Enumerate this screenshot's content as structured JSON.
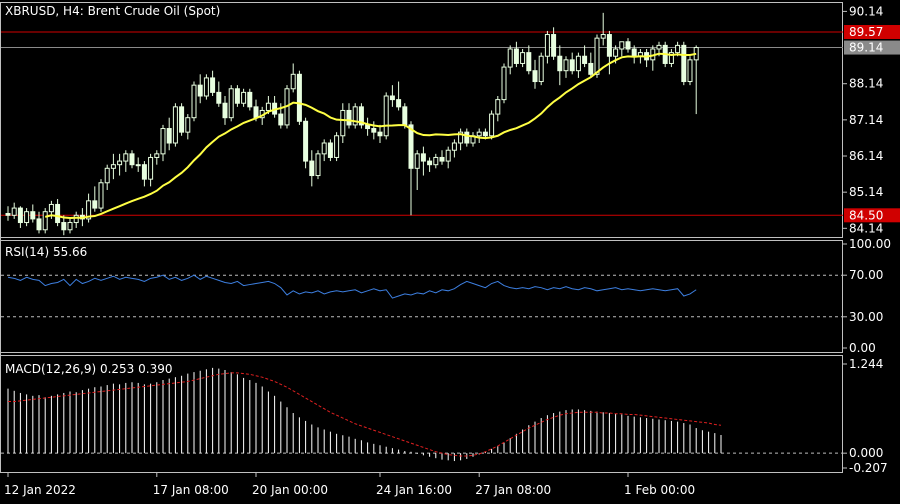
{
  "colors": {
    "background": "#000000",
    "frame": "#c0c0c0",
    "text": "#ffffff",
    "candle": "#e8ffe0",
    "ma": "#ffff44",
    "level_line": "#d00000",
    "bid_line": "#8a8a8a",
    "rsi_line": "#3d7fe0",
    "macd_hist": "#ffffff",
    "macd_signal": "#e02020",
    "grid_dash": "#bdbdbd"
  },
  "chart_data": [
    {
      "type": "candlestick",
      "title": "XBRUSD, H4:  Brent Crude Oil (Spot)",
      "ylim": [
        83.9,
        90.4
      ],
      "yticks": [
        "90.14",
        "88.14",
        "87.14",
        "86.14",
        "85.14",
        "84.14"
      ],
      "ytick_values": [
        90.14,
        88.14,
        87.14,
        86.14,
        85.14,
        84.14
      ],
      "xticks": [
        "12 Jan 2022",
        "17 Jan 08:00",
        "20 Jan 00:00",
        "24 Jan 16:00",
        "27 Jan 08:00",
        "1 Feb 00:00"
      ],
      "xtick_index": [
        0,
        24,
        40,
        60,
        76,
        100
      ],
      "levels": [
        {
          "label": "89.57",
          "value": 89.57
        },
        {
          "label": "84.50",
          "value": 84.5
        }
      ],
      "bid": {
        "label": "89.14",
        "value": 89.14
      },
      "candles": [
        [
          84.55,
          84.75,
          84.35,
          84.5
        ],
        [
          84.5,
          84.85,
          84.4,
          84.7
        ],
        [
          84.7,
          84.75,
          84.15,
          84.3
        ],
        [
          84.3,
          84.7,
          84.2,
          84.6
        ],
        [
          84.6,
          84.8,
          84.3,
          84.4
        ],
        [
          84.4,
          84.6,
          84.0,
          84.1
        ],
        [
          84.1,
          84.7,
          84.0,
          84.6
        ],
        [
          84.6,
          84.9,
          84.4,
          84.8
        ],
        [
          84.8,
          84.95,
          84.2,
          84.3
        ],
        [
          84.3,
          84.5,
          83.95,
          84.1
        ],
        [
          84.1,
          84.4,
          84.0,
          84.3
        ],
        [
          84.3,
          84.6,
          84.15,
          84.5
        ],
        [
          84.5,
          84.7,
          84.2,
          84.4
        ],
        [
          84.4,
          85.1,
          84.3,
          84.9
        ],
        [
          84.9,
          85.3,
          84.6,
          84.7
        ],
        [
          84.7,
          85.5,
          84.6,
          85.4
        ],
        [
          85.4,
          85.9,
          85.2,
          85.8
        ],
        [
          85.8,
          86.2,
          85.5,
          85.9
        ],
        [
          85.9,
          86.2,
          85.6,
          86.0
        ],
        [
          86.0,
          86.3,
          85.7,
          86.2
        ],
        [
          86.2,
          86.3,
          85.8,
          85.9
        ],
        [
          85.9,
          86.1,
          85.7,
          85.9
        ],
        [
          85.9,
          86.0,
          85.3,
          85.5
        ],
        [
          85.5,
          86.2,
          85.3,
          86.1
        ],
        [
          86.1,
          86.3,
          85.9,
          86.2
        ],
        [
          86.2,
          87.0,
          86.0,
          86.9
        ],
        [
          86.9,
          87.2,
          86.3,
          86.5
        ],
        [
          86.5,
          87.6,
          86.4,
          87.5
        ],
        [
          87.5,
          87.6,
          86.7,
          86.8
        ],
        [
          86.8,
          87.3,
          86.6,
          87.2
        ],
        [
          87.2,
          88.2,
          87.1,
          88.1
        ],
        [
          88.1,
          88.4,
          87.6,
          87.8
        ],
        [
          87.8,
          88.4,
          87.7,
          88.3
        ],
        [
          88.3,
          88.5,
          87.8,
          87.9
        ],
        [
          87.9,
          88.2,
          87.5,
          87.6
        ],
        [
          87.6,
          87.8,
          87.0,
          87.2
        ],
        [
          87.2,
          88.1,
          87.1,
          88.0
        ],
        [
          88.0,
          88.1,
          87.5,
          87.6
        ],
        [
          87.6,
          88.0,
          87.5,
          87.9
        ],
        [
          87.9,
          88.0,
          87.4,
          87.5
        ],
        [
          87.5,
          87.7,
          87.1,
          87.2
        ],
        [
          87.2,
          87.5,
          87.0,
          87.4
        ],
        [
          87.4,
          87.8,
          87.3,
          87.6
        ],
        [
          87.6,
          87.8,
          87.2,
          87.3
        ],
        [
          87.3,
          87.6,
          86.9,
          87.0
        ],
        [
          87.0,
          88.1,
          86.9,
          88.0
        ],
        [
          88.0,
          88.7,
          87.9,
          88.4
        ],
        [
          88.4,
          88.5,
          87.0,
          87.1
        ],
        [
          87.1,
          87.2,
          85.8,
          86.0
        ],
        [
          86.0,
          86.3,
          85.3,
          85.6
        ],
        [
          85.6,
          86.3,
          85.5,
          86.2
        ],
        [
          86.2,
          86.6,
          86.0,
          86.5
        ],
        [
          86.5,
          86.6,
          86.0,
          86.1
        ],
        [
          86.1,
          86.8,
          86.0,
          86.7
        ],
        [
          86.7,
          87.6,
          86.5,
          87.4
        ],
        [
          87.4,
          87.6,
          86.9,
          87.0
        ],
        [
          87.0,
          87.6,
          86.9,
          87.5
        ],
        [
          87.5,
          87.6,
          86.9,
          87.0
        ],
        [
          87.0,
          87.2,
          86.7,
          86.9
        ],
        [
          86.9,
          87.1,
          86.6,
          86.8
        ],
        [
          86.8,
          87.0,
          86.5,
          86.7
        ],
        [
          86.7,
          87.9,
          86.6,
          87.8
        ],
        [
          87.8,
          88.1,
          87.5,
          87.7
        ],
        [
          87.7,
          88.2,
          87.4,
          87.5
        ],
        [
          87.5,
          87.6,
          86.9,
          87.0
        ],
        [
          87.0,
          87.1,
          84.5,
          85.8
        ],
        [
          85.8,
          86.3,
          85.2,
          86.2
        ],
        [
          86.2,
          86.4,
          85.6,
          86.0
        ],
        [
          86.0,
          86.1,
          85.7,
          85.9
        ],
        [
          85.9,
          86.2,
          85.8,
          86.1
        ],
        [
          86.1,
          86.3,
          85.9,
          86.0
        ],
        [
          86.0,
          86.4,
          85.8,
          86.3
        ],
        [
          86.3,
          86.6,
          86.1,
          86.5
        ],
        [
          86.5,
          86.9,
          86.3,
          86.8
        ],
        [
          86.8,
          86.9,
          86.4,
          86.5
        ],
        [
          86.5,
          86.8,
          86.4,
          86.7
        ],
        [
          86.7,
          86.9,
          86.5,
          86.8
        ],
        [
          86.8,
          86.9,
          86.6,
          86.7
        ],
        [
          86.7,
          87.4,
          86.6,
          87.3
        ],
        [
          87.3,
          87.8,
          87.1,
          87.7
        ],
        [
          87.7,
          88.7,
          87.6,
          88.6
        ],
        [
          88.6,
          89.2,
          88.4,
          89.1
        ],
        [
          89.1,
          89.3,
          88.6,
          88.7
        ],
        [
          88.7,
          89.1,
          88.6,
          89.0
        ],
        [
          89.0,
          89.2,
          88.4,
          88.5
        ],
        [
          88.5,
          88.8,
          88.0,
          88.2
        ],
        [
          88.2,
          89.0,
          88.1,
          88.9
        ],
        [
          88.9,
          89.6,
          88.7,
          89.5
        ],
        [
          89.5,
          89.7,
          88.8,
          88.9
        ],
        [
          88.9,
          89.2,
          88.1,
          88.5
        ],
        [
          88.5,
          88.9,
          88.3,
          88.8
        ],
        [
          88.8,
          89.0,
          88.4,
          88.5
        ],
        [
          88.5,
          89.0,
          88.3,
          88.9
        ],
        [
          88.9,
          89.2,
          88.6,
          88.7
        ],
        [
          88.7,
          89.0,
          88.3,
          88.4
        ],
        [
          88.4,
          89.5,
          88.3,
          89.4
        ],
        [
          89.4,
          90.1,
          89.2,
          89.5
        ],
        [
          89.5,
          89.6,
          88.4,
          88.9
        ],
        [
          88.9,
          89.2,
          88.7,
          89.1
        ],
        [
          89.1,
          89.3,
          88.9,
          89.3
        ],
        [
          89.3,
          89.4,
          89.0,
          89.1
        ],
        [
          89.1,
          89.2,
          88.7,
          88.9
        ],
        [
          88.9,
          89.1,
          88.7,
          89.0
        ],
        [
          89.0,
          89.1,
          88.6,
          88.8
        ],
        [
          88.8,
          89.2,
          88.5,
          89.1
        ],
        [
          89.1,
          89.3,
          88.9,
          89.2
        ],
        [
          89.2,
          89.3,
          88.6,
          88.7
        ],
        [
          88.7,
          89.1,
          88.6,
          89.0
        ],
        [
          89.0,
          89.3,
          88.9,
          89.2
        ],
        [
          89.2,
          89.3,
          88.1,
          88.2
        ],
        [
          88.2,
          88.9,
          88.1,
          88.8
        ],
        [
          88.8,
          89.2,
          87.3,
          89.14
        ]
      ],
      "ma_period": 20
    },
    {
      "type": "line",
      "label": "RSI(14) 55.66",
      "ylim": [
        0,
        100
      ],
      "yticks": [
        "100.00",
        "70.00",
        "30.00",
        "0.00"
      ],
      "ytick_values": [
        100,
        70,
        30,
        0
      ],
      "dashed_levels": [
        70,
        30
      ],
      "values": [
        68,
        67,
        65,
        68,
        66,
        65,
        60,
        62,
        63,
        66,
        60,
        66,
        62,
        64,
        67,
        65,
        67,
        69,
        66,
        68,
        67,
        66,
        64,
        67,
        68,
        70,
        66,
        68,
        65,
        67,
        70,
        66,
        69,
        67,
        65,
        63,
        62,
        64,
        60,
        61,
        62,
        63,
        64,
        62,
        58,
        51,
        55,
        52,
        54,
        53,
        55,
        52,
        54,
        55,
        54,
        55,
        56,
        53,
        55,
        57,
        55,
        56,
        48,
        50,
        52,
        51,
        53,
        52,
        55,
        53,
        56,
        55,
        57,
        61,
        64,
        62,
        60,
        58,
        62,
        64,
        60,
        58,
        57,
        58,
        57,
        59,
        58,
        56,
        58,
        57,
        59,
        57,
        56,
        58,
        57,
        55,
        56,
        57,
        58,
        56,
        57,
        56,
        55,
        56,
        57,
        56,
        55,
        56,
        57,
        50,
        52,
        56
      ]
    },
    {
      "type": "bar",
      "label": "MACD(12,26,9) 0.253 0.390",
      "ylim": [
        -0.207,
        1.244
      ],
      "yticks": [
        "1.244",
        "0.000",
        "-0.207"
      ],
      "ytick_values": [
        1.244,
        0.0,
        -0.207
      ],
      "values": [
        0.9,
        0.87,
        0.84,
        0.82,
        0.8,
        0.81,
        0.78,
        0.8,
        0.82,
        0.84,
        0.86,
        0.85,
        0.88,
        0.9,
        0.92,
        0.93,
        0.95,
        0.97,
        0.96,
        0.98,
        0.99,
        0.98,
        0.96,
        0.97,
        0.99,
        1.02,
        1.04,
        1.06,
        1.08,
        1.11,
        1.13,
        1.15,
        1.17,
        1.19,
        1.18,
        1.16,
        1.13,
        1.1,
        1.05,
        1.02,
        0.98,
        0.93,
        0.86,
        0.8,
        0.72,
        0.64,
        0.56,
        0.5,
        0.45,
        0.4,
        0.36,
        0.33,
        0.3,
        0.27,
        0.25,
        0.23,
        0.2,
        0.18,
        0.15,
        0.13,
        0.11,
        0.09,
        0.07,
        0.05,
        0.03,
        0.02,
        -0.01,
        -0.03,
        -0.05,
        -0.07,
        -0.09,
        -0.1,
        -0.11,
        -0.1,
        -0.08,
        -0.05,
        -0.02,
        0.02,
        0.06,
        0.1,
        0.15,
        0.21,
        0.27,
        0.33,
        0.39,
        0.44,
        0.49,
        0.53,
        0.56,
        0.58,
        0.6,
        0.61,
        0.61,
        0.6,
        0.59,
        0.58,
        0.57,
        0.56,
        0.55,
        0.54,
        0.52,
        0.51,
        0.5,
        0.49,
        0.48,
        0.47,
        0.46,
        0.45,
        0.44,
        0.42,
        0.4,
        0.35,
        0.32,
        0.3,
        0.28,
        0.253
      ],
      "signal": [
        0.72,
        0.72,
        0.73,
        0.74,
        0.75,
        0.76,
        0.77,
        0.78,
        0.79,
        0.8,
        0.81,
        0.82,
        0.83,
        0.84,
        0.85,
        0.86,
        0.87,
        0.88,
        0.89,
        0.9,
        0.91,
        0.92,
        0.93,
        0.94,
        0.95,
        0.96,
        0.97,
        0.98,
        0.99,
        1.0,
        1.02,
        1.04,
        1.06,
        1.08,
        1.1,
        1.11,
        1.12,
        1.12,
        1.11,
        1.1,
        1.08,
        1.06,
        1.03,
        1.0,
        0.96,
        0.92,
        0.87,
        0.82,
        0.77,
        0.72,
        0.67,
        0.62,
        0.57,
        0.53,
        0.49,
        0.45,
        0.41,
        0.38,
        0.35,
        0.32,
        0.29,
        0.26,
        0.23,
        0.2,
        0.17,
        0.14,
        0.11,
        0.08,
        0.05,
        0.02,
        0.0,
        -0.02,
        -0.03,
        -0.04,
        -0.04,
        -0.03,
        -0.01,
        0.02,
        0.06,
        0.1,
        0.15,
        0.2,
        0.25,
        0.3,
        0.35,
        0.39,
        0.43,
        0.47,
        0.5,
        0.53,
        0.55,
        0.56,
        0.57,
        0.57,
        0.57,
        0.57,
        0.56,
        0.56,
        0.55,
        0.55,
        0.54,
        0.54,
        0.53,
        0.52,
        0.51,
        0.5,
        0.49,
        0.48,
        0.47,
        0.46,
        0.45,
        0.44,
        0.43,
        0.42,
        0.4,
        0.39
      ]
    }
  ]
}
